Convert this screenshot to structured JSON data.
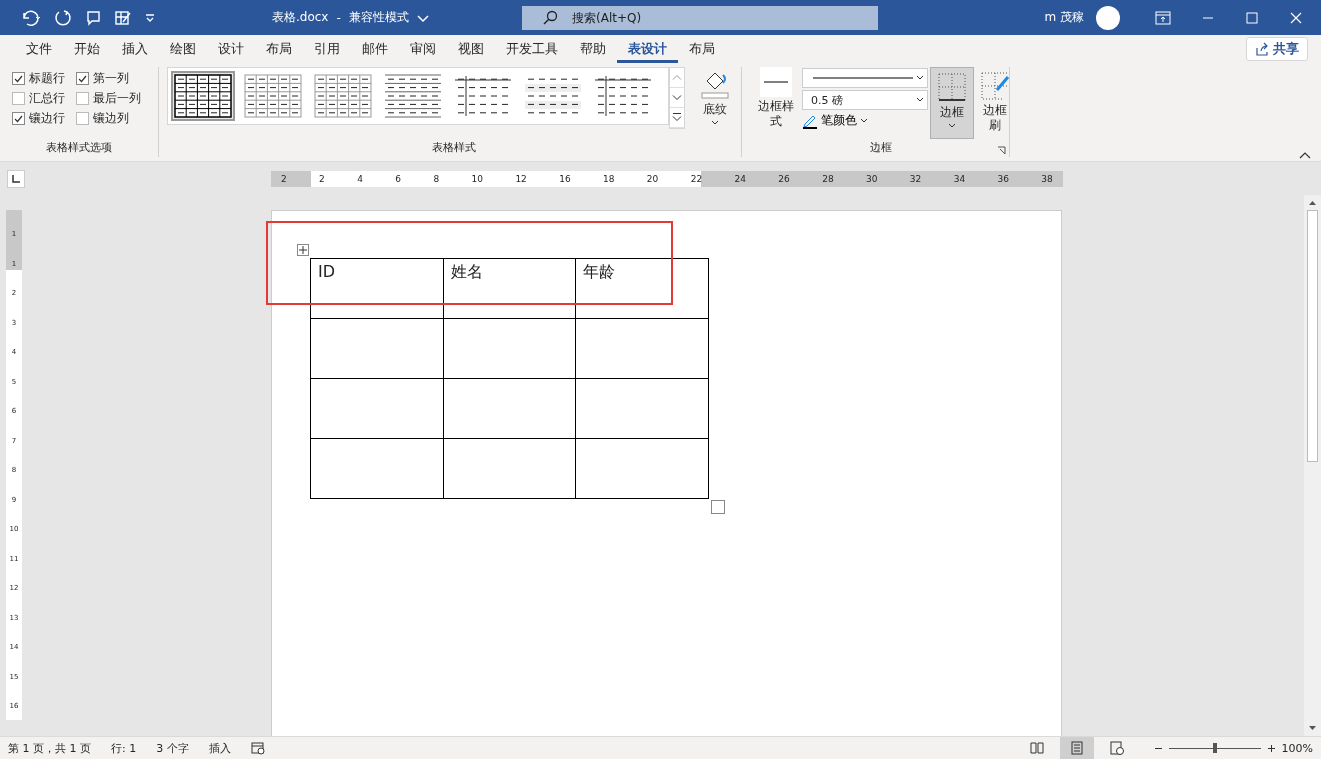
{
  "title_bar": {
    "document_title": "表格.docx",
    "separator": "-",
    "mode": "兼容性模式",
    "search_placeholder": "搜索(Alt+Q)",
    "user": "m 茂稼"
  },
  "ribbon_tabs": [
    {
      "label": "文件",
      "selected": false
    },
    {
      "label": "开始",
      "selected": false
    },
    {
      "label": "插入",
      "selected": false
    },
    {
      "label": "绘图",
      "selected": false
    },
    {
      "label": "设计",
      "selected": false
    },
    {
      "label": "布局",
      "selected": false
    },
    {
      "label": "引用",
      "selected": false
    },
    {
      "label": "邮件",
      "selected": false
    },
    {
      "label": "审阅",
      "selected": false
    },
    {
      "label": "视图",
      "selected": false
    },
    {
      "label": "开发工具",
      "selected": false
    },
    {
      "label": "帮助",
      "selected": false
    },
    {
      "label": "表设计",
      "selected": true
    },
    {
      "label": "布局",
      "selected": false
    }
  ],
  "share_button": "共享",
  "style_options": {
    "group_label": "表格样式选项",
    "items": [
      {
        "label": "标题行",
        "checked": true
      },
      {
        "label": "第一列",
        "checked": true
      },
      {
        "label": "汇总行",
        "checked": false
      },
      {
        "label": "最后一列",
        "checked": false
      },
      {
        "label": "镶边行",
        "checked": true
      },
      {
        "label": "镶边列",
        "checked": false
      }
    ]
  },
  "table_styles": {
    "group_label": "表格样式",
    "shading_button": "底纹",
    "styles": [
      {
        "kind": "grid",
        "selected": true
      },
      {
        "kind": "light",
        "selected": false
      },
      {
        "kind": "light",
        "selected": false
      },
      {
        "kind": "lines",
        "selected": false
      },
      {
        "kind": "firstcol",
        "selected": false
      },
      {
        "kind": "banded",
        "selected": false
      },
      {
        "kind": "firstcol",
        "selected": false
      }
    ]
  },
  "borders": {
    "group_label": "边框",
    "border_styles_button": "边框样式",
    "weight": "0.5 磅",
    "pen_color": "笔颜色",
    "borders_button": "边框",
    "painter_button": "边框刷"
  },
  "ruler": {
    "labels": [
      "2",
      "2",
      "4",
      "6",
      "8",
      "10",
      "12",
      "16",
      "18",
      "20",
      "22",
      "24",
      "26",
      "28",
      "30",
      "32",
      "34",
      "36",
      "38"
    ],
    "vertical_labels": [
      "1",
      "1",
      "2",
      "3",
      "4",
      "5",
      "6",
      "7",
      "8",
      "9",
      "10",
      "11",
      "12",
      "13",
      "14",
      "15",
      "16"
    ]
  },
  "document": {
    "table": {
      "rows": [
        {
          "cells": [
            "ID",
            "姓名",
            "年龄"
          ]
        }
      ]
    }
  },
  "status_bar": {
    "page": "第 1 页，共 1 页",
    "line": "行: 1",
    "words": "3 个字",
    "mode": "插入",
    "zoom": "100%",
    "zoom_slider": {
      "level": 0.5
    },
    "view_buttons": [
      {
        "kind": "read",
        "selected": false
      },
      {
        "kind": "print",
        "selected": true
      },
      {
        "kind": "web",
        "selected": false
      }
    ]
  }
}
